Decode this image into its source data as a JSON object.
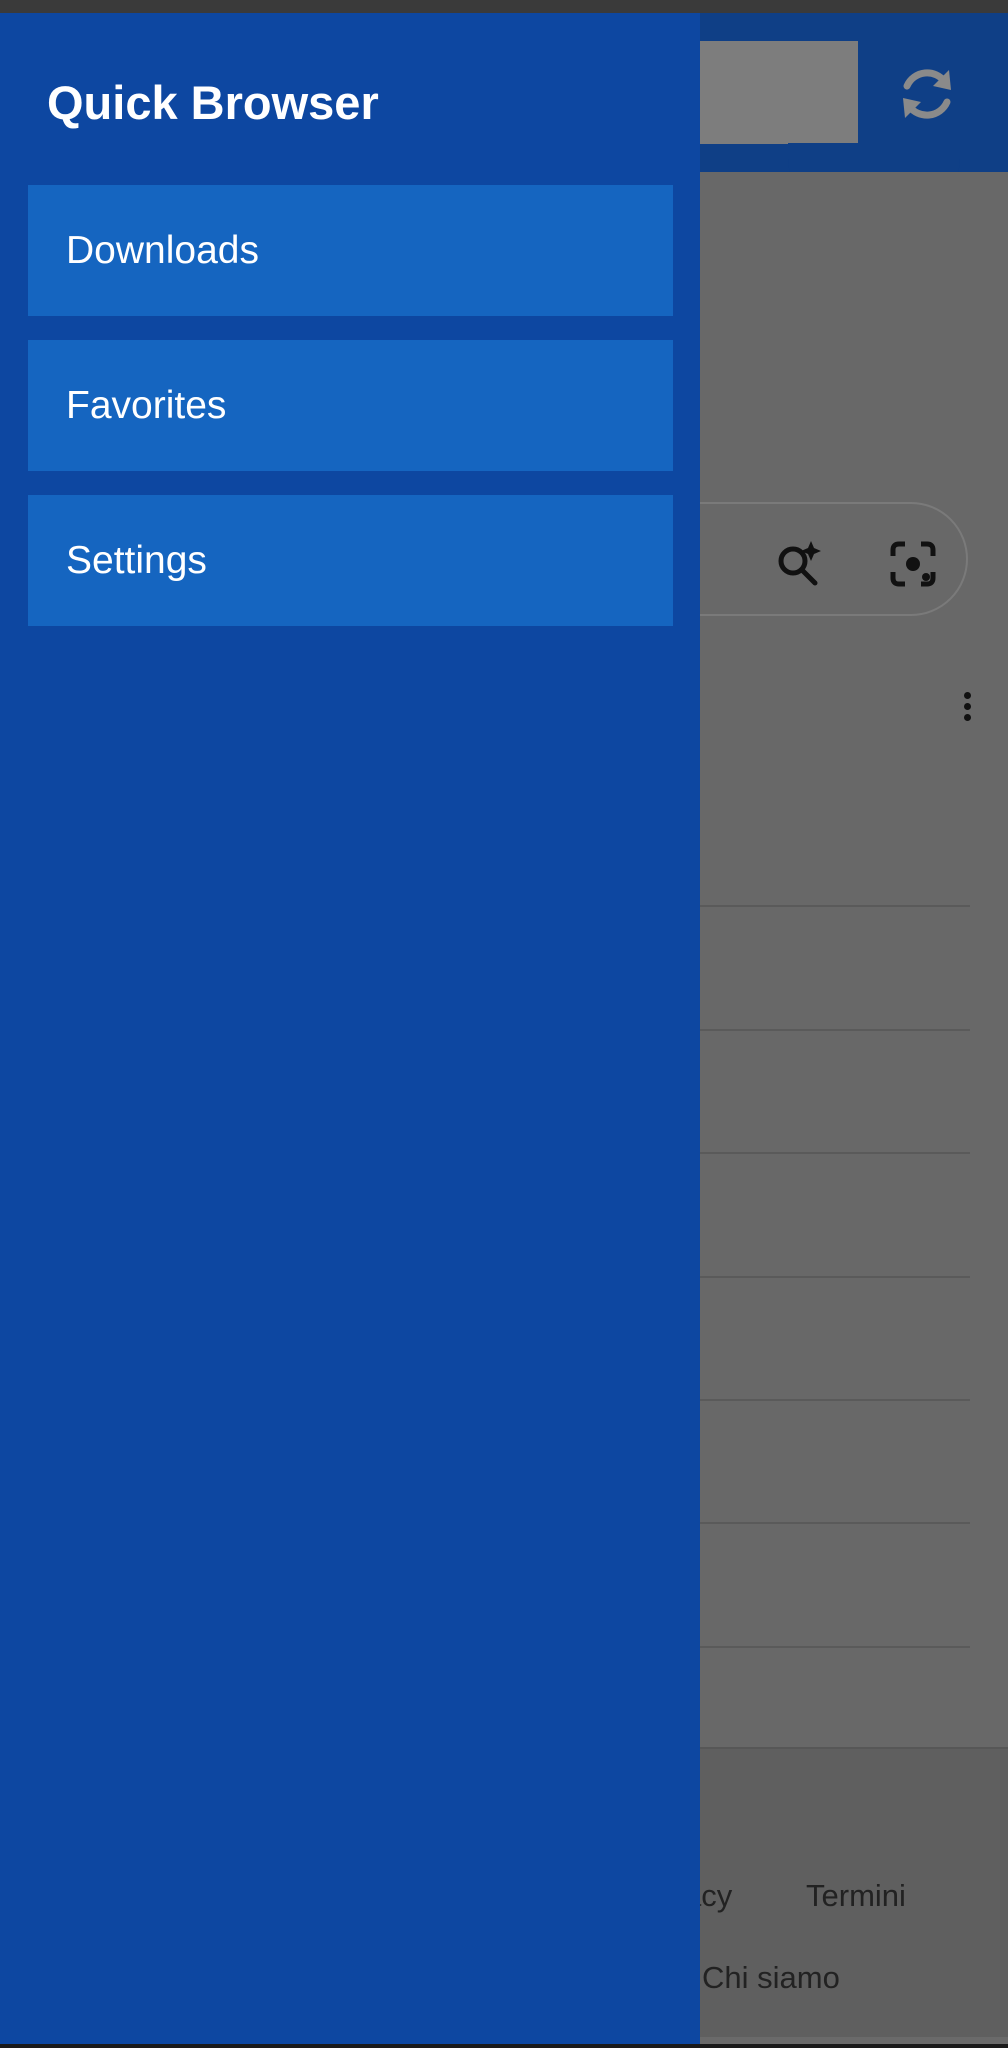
{
  "app": {
    "title": "Quick Browser"
  },
  "drawer": {
    "items": [
      {
        "label": "Downloads"
      },
      {
        "label": "Favorites"
      },
      {
        "label": "Settings"
      }
    ]
  },
  "background_page": {
    "footer_links": [
      "acy",
      "Termini",
      "Chi siamo"
    ]
  },
  "colors": {
    "drawer_background": "#0d47a1",
    "drawer_item": "#1565c0",
    "toolbar": "#0f3f86",
    "scrim_page": "#686868"
  },
  "icons": {
    "refresh": "refresh-icon",
    "ai_search": "ai-search-icon",
    "lens": "camera-lens-icon",
    "more": "more-vertical-icon"
  }
}
